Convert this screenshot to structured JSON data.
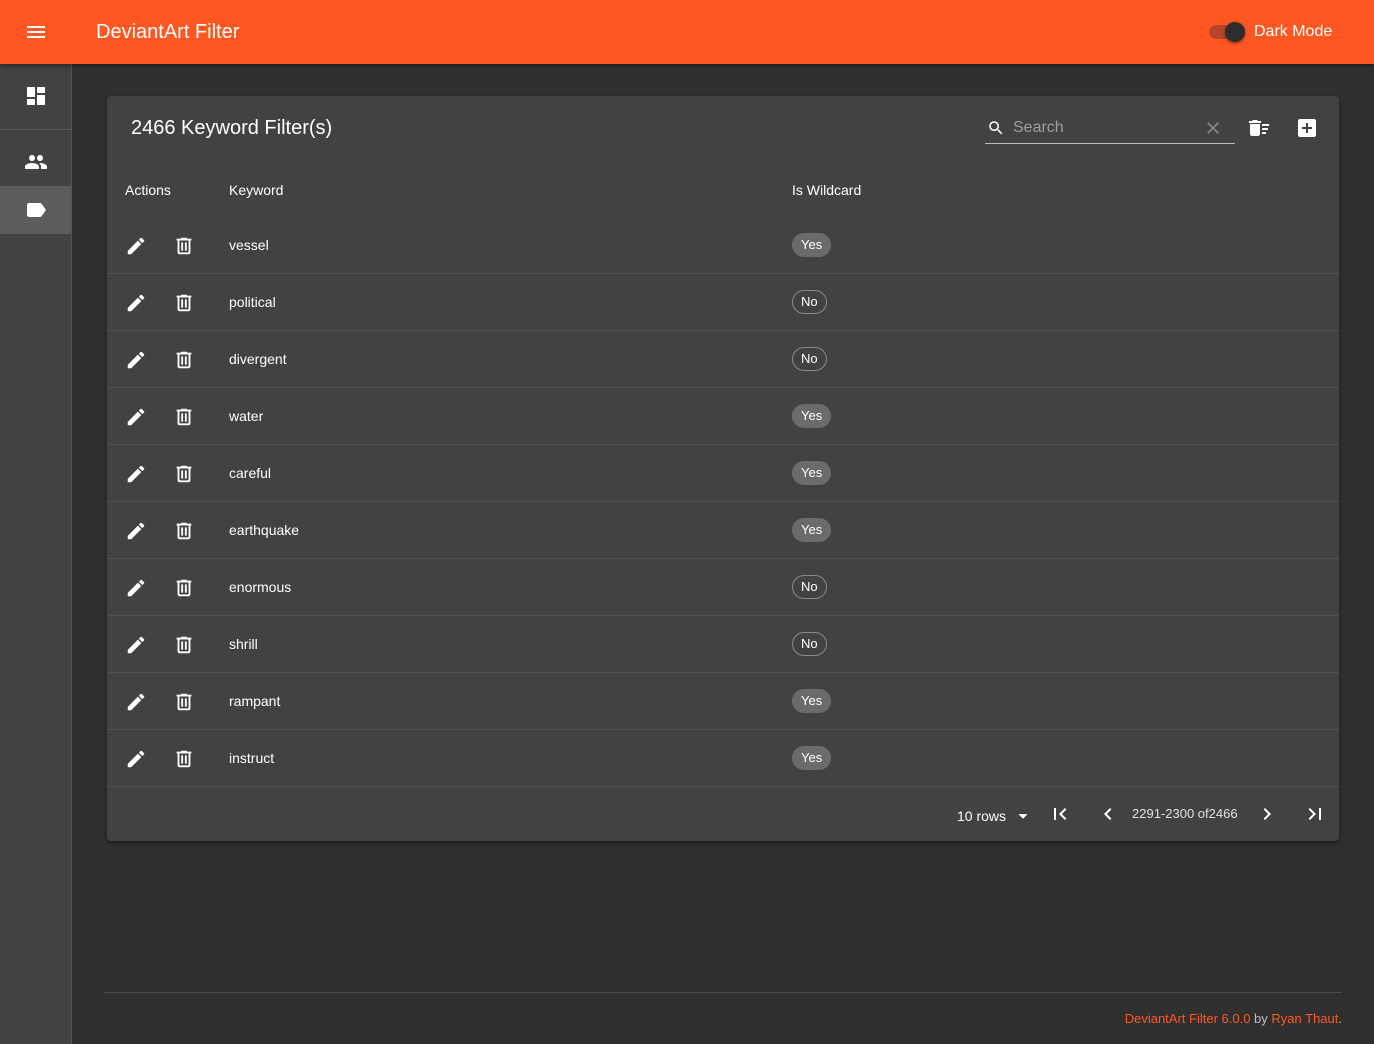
{
  "header": {
    "app_title": "DeviantArt Filter",
    "dark_mode_label": "Dark Mode",
    "dark_mode_on": true,
    "accent_color": "#ff5722"
  },
  "sidebar": {
    "items": [
      {
        "name": "dashboard",
        "icon": "dashboard-icon",
        "active": false
      },
      {
        "name": "users",
        "icon": "people-icon",
        "active": false
      },
      {
        "name": "keywords",
        "icon": "label-icon",
        "active": true
      }
    ]
  },
  "table": {
    "title": "2466 Keyword Filter(s)",
    "search_placeholder": "Search",
    "columns": {
      "actions": "Actions",
      "keyword": "Keyword",
      "wildcard": "Is Wildcard"
    },
    "rows": [
      {
        "keyword": "vessel",
        "wildcard": "Yes"
      },
      {
        "keyword": "political",
        "wildcard": "No"
      },
      {
        "keyword": "divergent",
        "wildcard": "No"
      },
      {
        "keyword": "water",
        "wildcard": "Yes"
      },
      {
        "keyword": "careful",
        "wildcard": "Yes"
      },
      {
        "keyword": "earthquake",
        "wildcard": "Yes"
      },
      {
        "keyword": "enormous",
        "wildcard": "No"
      },
      {
        "keyword": "shrill",
        "wildcard": "No"
      },
      {
        "keyword": "rampant",
        "wildcard": "Yes"
      },
      {
        "keyword": "instruct",
        "wildcard": "Yes"
      }
    ],
    "pagination": {
      "rows_per_page": "10 rows",
      "range": "2291-2300",
      "of_label": "of",
      "total": "2466"
    }
  },
  "footer": {
    "app_link": "DeviantArt Filter 6.0.0",
    "by": "by",
    "author_link": "Ryan Thaut",
    "end": "."
  }
}
